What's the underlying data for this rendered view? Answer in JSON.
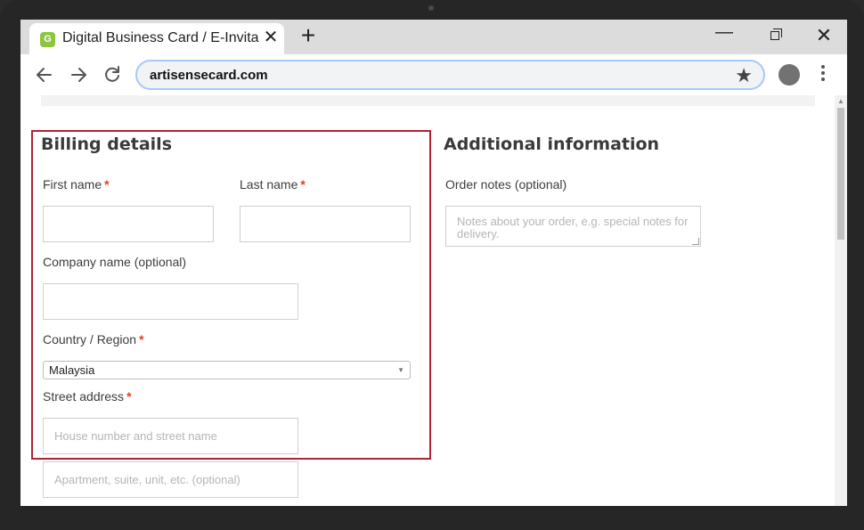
{
  "browser": {
    "tab_title": "Digital Business Card / E-Invita",
    "tab_favicon_letter": "G",
    "url": "artisensecard.com",
    "accent_color": "#a8c7fa",
    "favicon_color": "#8cc63f"
  },
  "billing": {
    "title": "Billing details",
    "first_name_label": "First name",
    "last_name_label": "Last name",
    "company_label": "Company name (optional)",
    "country_label": "Country / Region",
    "country_value": "Malaysia",
    "street_label": "Street address",
    "street_placeholder": "House number and street name",
    "apartment_placeholder": "Apartment, suite, unit, etc. (optional)",
    "required_mark": "*",
    "highlight_color": "#b22234"
  },
  "additional": {
    "title": "Additional information",
    "order_notes_label": "Order notes (optional)",
    "order_notes_placeholder": "Notes about your order, e.g. special notes for delivery."
  }
}
